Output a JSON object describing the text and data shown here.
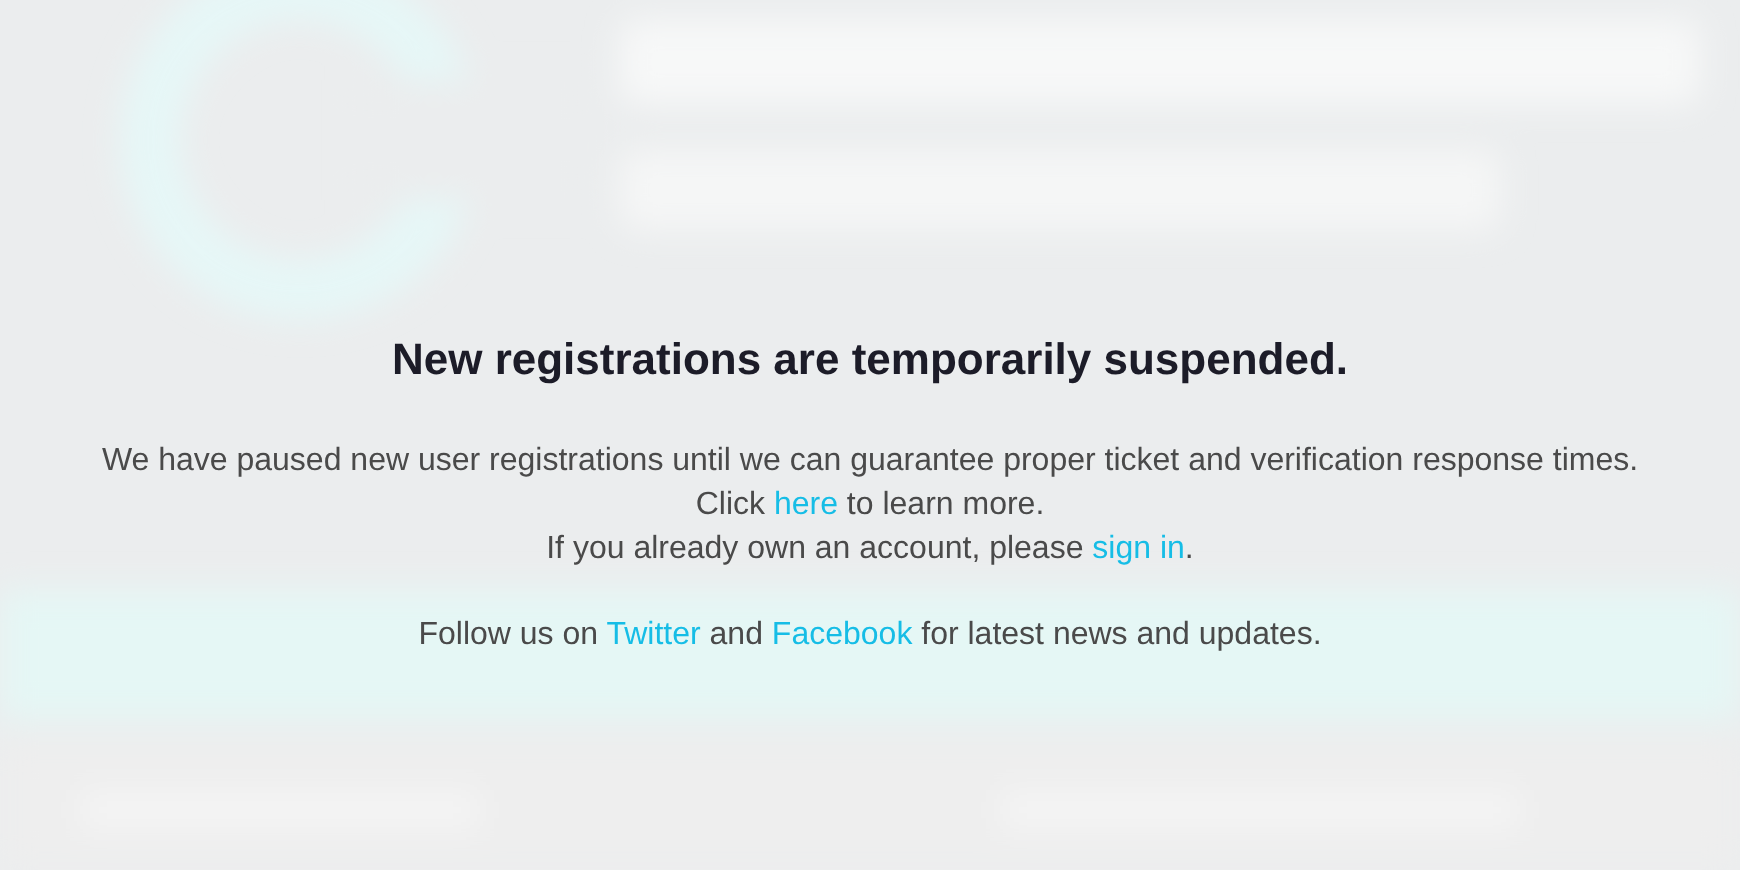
{
  "notice": {
    "title": "New registrations are temporarily suspended.",
    "lines": [
      {
        "before": "We have paused new user registrations until we can guarantee proper ticket and verification response times."
      },
      {
        "before": "Click ",
        "link": "here",
        "after": " to learn more."
      },
      {
        "before": "If you already own an account, please ",
        "link": "sign in",
        "after": "."
      }
    ],
    "follow": [
      {
        "text": "Follow us on "
      },
      {
        "link": "Twitter"
      },
      {
        "text": " and "
      },
      {
        "link": "Facebook"
      },
      {
        "text": " for latest news and updates."
      }
    ]
  }
}
